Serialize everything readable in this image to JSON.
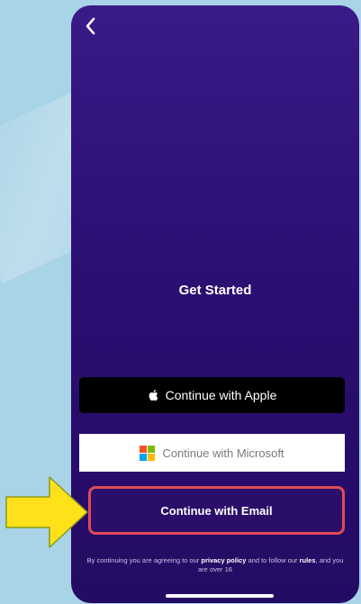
{
  "screen": {
    "title": "Get Started",
    "back_icon": "chevron-left-icon"
  },
  "buttons": {
    "apple": {
      "label": "Continue with Apple",
      "icon": "apple-logo-icon"
    },
    "microsoft": {
      "label": "Continue with Microsoft",
      "icon": "microsoft-logo-icon"
    },
    "email": {
      "label": "Continue with Email",
      "highlight_color": "#e04b57"
    }
  },
  "legal": {
    "prefix": "By continuing you are agreeing to our ",
    "privacy_link": "privacy policy",
    "middle": " and to follow our ",
    "rules_link": "rules",
    "suffix": ", and you are over 16"
  },
  "annotation": {
    "arrow_color": "#ffe11a",
    "arrow_outline": "#8a9a1a"
  },
  "colors": {
    "background": "#a9d3e6",
    "phone_gradient_top": "#3a1a87",
    "phone_gradient_bottom": "#240b63"
  }
}
